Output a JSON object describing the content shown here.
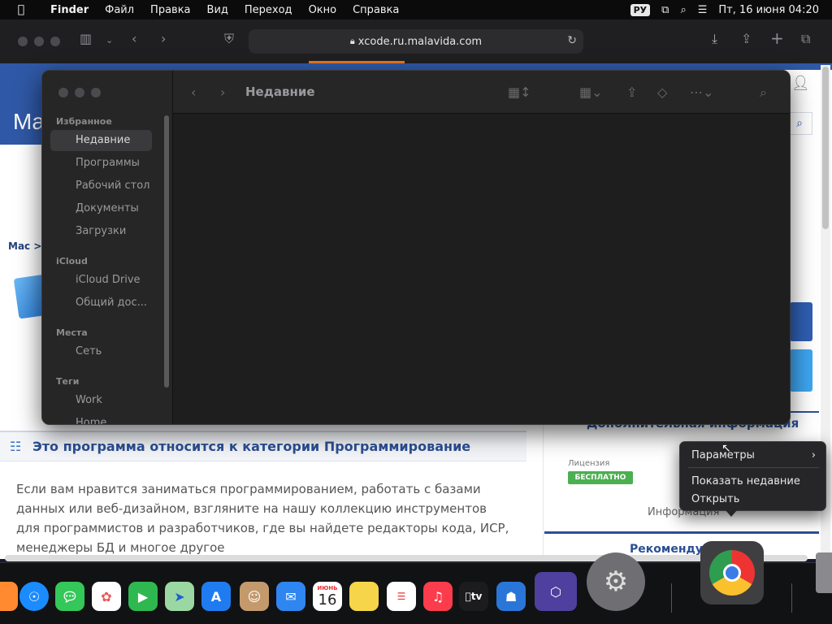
{
  "menubar": {
    "apple": "",
    "items": [
      "Finder",
      "Файл",
      "Правка",
      "Вид",
      "Переход",
      "Окно",
      "Справка"
    ],
    "keyboard": "РУ",
    "datetime": "Пт, 16 июня  04:20"
  },
  "safari": {
    "url": "xcode.ru.malavida.com"
  },
  "page": {
    "logo": "Ma",
    "breadcrumb": "Mac > ",
    "category_title": "Это программа относится к категории Программирование",
    "description": "Если вам нравится заниматься программированием, работать с базами данных или веб-дизайном, взгляните на нашу коллекцию инструментов для программистов и разработчиков, где вы найдете редакторы кода, ИСР, менеджеры БД и многое другое",
    "additional_info": "Дополнительная информация",
    "license_label": "Лицензия",
    "license_value": "БЕСПЛАТНО",
    "info": "Информация",
    "recommended": "Рекоменду"
  },
  "finder": {
    "title": "Недавние",
    "sections": [
      {
        "header": "Избранное",
        "items": [
          "Недавние",
          "Программы",
          "Рабочий стол",
          "Документы",
          "Загрузки"
        ]
      },
      {
        "header": "iCloud",
        "items": [
          "iCloud Drive",
          "Общий дос..."
        ]
      },
      {
        "header": "Места",
        "items": [
          "Сеть"
        ]
      },
      {
        "header": "Теги",
        "items": [
          "Work",
          "Home"
        ]
      }
    ]
  },
  "context_menu": {
    "items": [
      "Параметры",
      "Показать недавние",
      "Открыть"
    ]
  },
  "dock": {
    "calendar_month": "ИЮНЬ",
    "calendar_day": "16",
    "tv_label": "tv",
    "colors": {
      "safari": "#1a8cff",
      "messages": "#34c759",
      "facetime": "#2fb84f",
      "appstore": "#1f7cf0",
      "mail": "#2f86f0",
      "notes": "#f7d54a",
      "music": "#fa3c4c",
      "tv": "#1c1c1e",
      "keynote": "#2a76d8",
      "chrome": "#d7d7d7"
    }
  }
}
